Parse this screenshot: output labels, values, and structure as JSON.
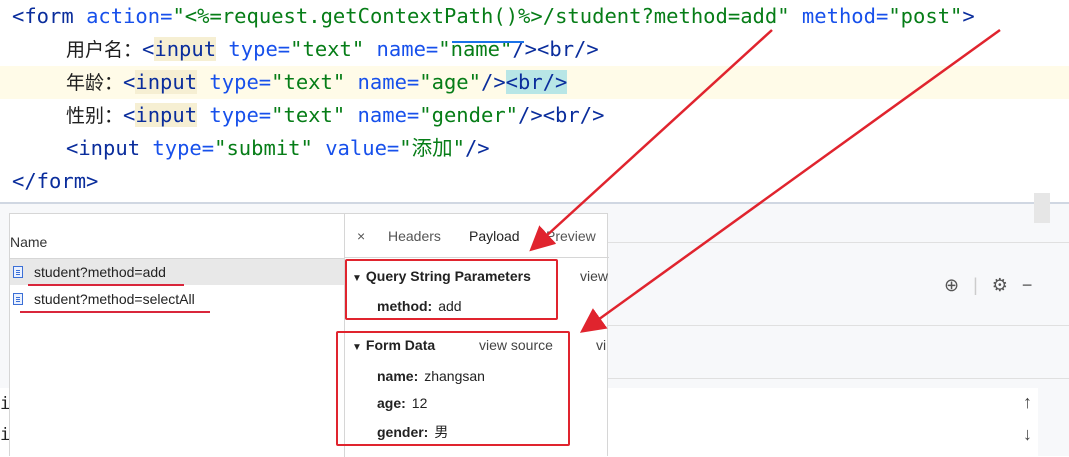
{
  "editor": {
    "line1": {
      "open": "<form ",
      "attr1": "action=",
      "val1": "\"<%=request.getContextPath()%>/student?method=add\"",
      "sp": " ",
      "attr2": "method=",
      "val2": "\"post\"",
      "close": ">"
    },
    "line2": {
      "label": "用户名：",
      "lt": "<",
      "tag": "input",
      "sp": " ",
      "attr1": "type=",
      "val1": "\"text\"",
      "attr2": "name=",
      "val2": "\"name\"",
      "end": "/><br/>"
    },
    "line3": {
      "label": "年龄：",
      "lt": "<",
      "tag": "input",
      "sp": " ",
      "attr1": "type=",
      "val1": "\"text\"",
      "attr2": "name=",
      "val2": "\"age\"",
      "end1": "/>",
      "br": "<br/>"
    },
    "line4": {
      "label": "性别：",
      "lt": "<",
      "tag": "input",
      "sp": " ",
      "attr1": "type=",
      "val1": "\"text\"",
      "attr2": "name=",
      "val2": "\"gender\"",
      "end": "/><br/>"
    },
    "line5": {
      "lt": "<",
      "tag": "input",
      "sp": " ",
      "attr1": "type=",
      "val1": "\"submit\"",
      "attr2": "value=",
      "val2": "\"添加\"",
      "end": "/>"
    },
    "line6": {
      "close": "</form>"
    }
  },
  "devtools": {
    "name_header": "Name",
    "requests": [
      {
        "label": "student?method=add",
        "selected": true
      },
      {
        "label": "student?method=selectAll",
        "selected": false
      }
    ],
    "tabs": {
      "close": "×",
      "headers": "Headers",
      "payload": "Payload",
      "preview": "Preview"
    },
    "query_section": {
      "title": "Query String Parameters",
      "view": "view",
      "params": [
        {
          "key": "method:",
          "value": "add"
        }
      ]
    },
    "form_section": {
      "title": "Form Data",
      "view_source": "view source",
      "extra": "vi",
      "fields": [
        {
          "key": "name:",
          "value": "zhangsan"
        },
        {
          "key": "age:",
          "value": "12"
        },
        {
          "key": "gender:",
          "value": "男"
        }
      ]
    }
  },
  "console": {
    "lines": [
      "i",
      "i"
    ]
  },
  "toolbar": {
    "target_icon": "⊕",
    "gear_icon": "⚙",
    "minus_icon": "−",
    "sep": "|"
  },
  "scroll": {
    "up": "↑",
    "down": "↓"
  },
  "colors": {
    "annotation": "#e0242e",
    "accent": "#1a73e8"
  }
}
